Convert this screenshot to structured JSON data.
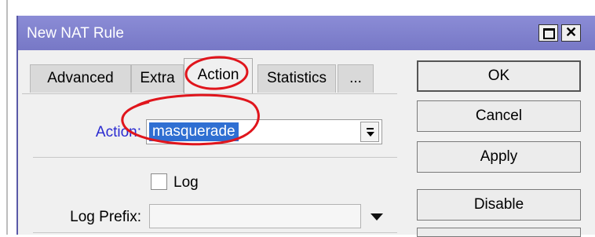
{
  "window": {
    "title": "New NAT Rule"
  },
  "title_buttons": {
    "close_glyph": "✕"
  },
  "tabs": [
    {
      "label": "Advanced"
    },
    {
      "label": "Extra"
    },
    {
      "label": "Action"
    },
    {
      "label": "Statistics"
    },
    {
      "label": "..."
    }
  ],
  "active_tab": "Action",
  "form": {
    "action_label": "Action:",
    "action_value": "masquerade",
    "log_label": "Log",
    "log_checked": false,
    "log_prefix_label": "Log Prefix:",
    "log_prefix_value": ""
  },
  "buttons": {
    "ok": "OK",
    "cancel": "Cancel",
    "apply": "Apply",
    "disable": "Disable"
  },
  "icons": {
    "maximize": "maximize-icon",
    "close": "close-icon",
    "dropdown": "dropdown-arrow-icon"
  },
  "colors": {
    "titlebar": "#7f80cf",
    "action_label": "#2a2ad0",
    "selection": "#2f6fd2",
    "annotation": "#e0151c"
  }
}
